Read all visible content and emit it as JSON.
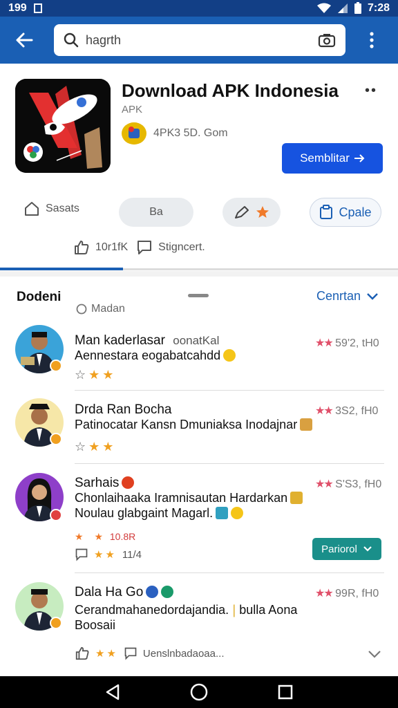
{
  "status_bar": {
    "time_left": "199",
    "time_right": "7:28"
  },
  "search": {
    "value": "hagrth",
    "placeholder": "hagrth"
  },
  "app": {
    "title": "Download APK  Indonesia",
    "subtitle": "APK",
    "developer": "4PK3 5D. Gom",
    "primary_button": "Semblitar"
  },
  "chips": {
    "first": "Sasats",
    "second": "Ba",
    "outline": "Cpale"
  },
  "stats": {
    "likes": "10r1fK",
    "comments": "Stigncert."
  },
  "reviews_header": {
    "title": "Dodeni",
    "filter": "Madan",
    "sort": "Cenrtan"
  },
  "reviews": [
    {
      "name": "Man  kaderlasar",
      "name_extra": "oonatKal",
      "line1": "Aennestara eogabatcahdd",
      "line2": "",
      "score": "59'2, tH0",
      "avatar_bg": "#3aa3d9",
      "badge_color": "#f0a020"
    },
    {
      "name": "Drda Ran Bocha",
      "name_extra": "",
      "line1": "Patinocatar Kansn Dmuniaksa Inodajnar",
      "line2": "",
      "score": "3S2, fH0",
      "avatar_bg": "#f6e7a8",
      "badge_color": "#f0a020"
    },
    {
      "name": "Sarhais",
      "name_extra": "",
      "line1": "Chonlaihaaka Iramnisautan Hardarkan",
      "line2": "Noulau glabgaint Magarl.",
      "score": "S'S3, fH0",
      "avatar_bg": "#8e3fc9",
      "badge_color": "#e04040",
      "meta": "10.8R",
      "meta2": "11/4",
      "button": "Pariorol"
    },
    {
      "name": "Dala Ha Go",
      "name_extra": "",
      "line1": "Cerandmahanedordajandia.",
      "line1_extra": "bulla Aona",
      "line2": "Boosaii",
      "score": "99R, fH0",
      "avatar_bg": "#c7ecc0",
      "badge_color": "#f0a020",
      "footer": "Uenslnbadaoaa..."
    }
  ],
  "colors": {
    "brand": "#1a5fb4",
    "primary_button": "#1653e0",
    "teal_button": "#1a8f8a",
    "star": "#f0a020"
  }
}
